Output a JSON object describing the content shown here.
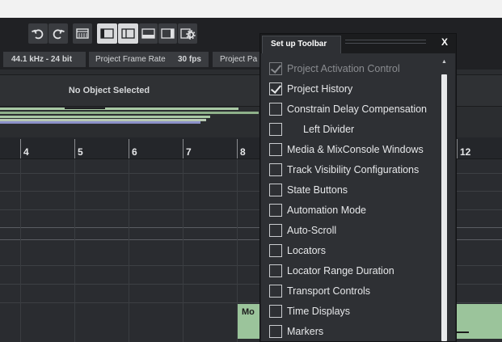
{
  "infobar": {
    "sample_rate": "44.1 kHz - 24 bit",
    "frame_rate_label": "Project Frame Rate",
    "frame_rate_value": "30 fps",
    "project_pan_truncated": "Project Pa"
  },
  "info_line": {
    "status": "No Object Selected"
  },
  "ruler": {
    "bars": [
      "4",
      "5",
      "6",
      "7",
      "8",
      "12"
    ]
  },
  "clip": {
    "label_truncated": "Mo"
  },
  "dialog": {
    "title": "Set up Toolbar",
    "close_glyph": "X",
    "scroll_up_glyph": "▲",
    "items": [
      {
        "label": "Project Activation Control",
        "checked": true,
        "disabled": true,
        "indent": false
      },
      {
        "label": "Project History",
        "checked": true,
        "disabled": false,
        "indent": false
      },
      {
        "label": "Constrain Delay Compensation",
        "checked": false,
        "disabled": false,
        "indent": false
      },
      {
        "label": "Left Divider",
        "checked": false,
        "disabled": false,
        "indent": true
      },
      {
        "label": "Media & MixConsole Windows",
        "checked": false,
        "disabled": false,
        "indent": false
      },
      {
        "label": "Track Visibility Configurations",
        "checked": false,
        "disabled": false,
        "indent": false
      },
      {
        "label": "State Buttons",
        "checked": false,
        "disabled": false,
        "indent": false
      },
      {
        "label": "Automation Mode",
        "checked": false,
        "disabled": false,
        "indent": false
      },
      {
        "label": "Auto-Scroll",
        "checked": false,
        "disabled": false,
        "indent": false
      },
      {
        "label": "Locators",
        "checked": false,
        "disabled": false,
        "indent": false
      },
      {
        "label": "Locator Range Duration",
        "checked": false,
        "disabled": false,
        "indent": false
      },
      {
        "label": "Transport Controls",
        "checked": false,
        "disabled": false,
        "indent": false
      },
      {
        "label": "Time Displays",
        "checked": false,
        "disabled": false,
        "indent": false
      },
      {
        "label": "Markers",
        "checked": false,
        "disabled": false,
        "indent": false
      }
    ]
  },
  "toolbar_icons": [
    "undo-icon",
    "redo-icon",
    "media-bay-icon",
    "left-zone-icon",
    "right-zone-panel-icon",
    "lower-zone-icon",
    "right-zone-icon",
    "toolbar-settings-icon"
  ],
  "colors": {
    "clip": "#9bc49b",
    "dialog_bg": "#2e3034",
    "toolbar_bg": "#202124"
  }
}
